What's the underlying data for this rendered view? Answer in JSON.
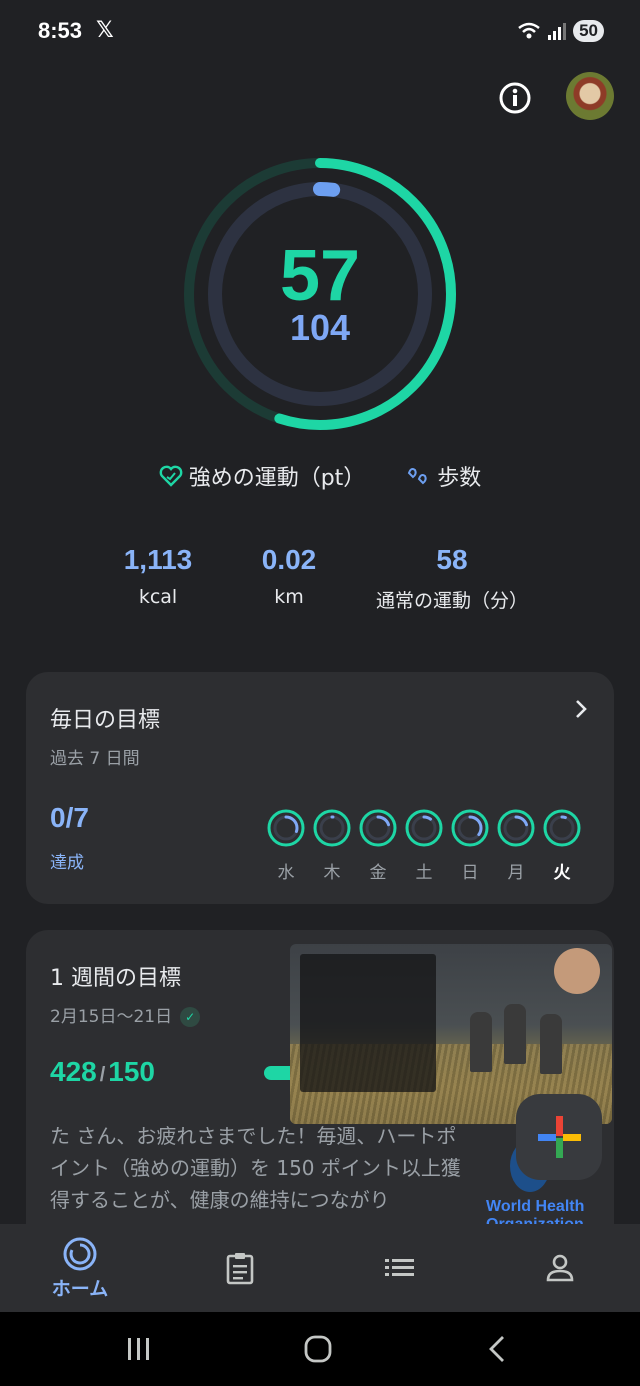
{
  "status_bar": {
    "time": "8:53",
    "battery": "50",
    "x_icon": "x-icon"
  },
  "rings": {
    "heart_points": "57",
    "steps": "104",
    "heart_fraction": 0.55,
    "steps_fraction": 0.02
  },
  "legend": {
    "heart_label": "強めの運動（pt）",
    "steps_label": "歩数"
  },
  "stats": [
    {
      "value": "1,113",
      "label": "kcal"
    },
    {
      "value": "0.02",
      "label": "km"
    },
    {
      "value": "58",
      "label": "通常の運動（分）"
    }
  ],
  "daily_goal": {
    "title": "毎日の目標",
    "subtitle": "過去 7 日間",
    "count": "0/7",
    "count_label": "達成",
    "days": [
      {
        "label": "水",
        "progress": 0.3
      },
      {
        "label": "木",
        "progress": 0.0
      },
      {
        "label": "金",
        "progress": 0.2
      },
      {
        "label": "土",
        "progress": 0.1
      },
      {
        "label": "日",
        "progress": 0.35
      },
      {
        "label": "月",
        "progress": 0.2
      },
      {
        "label": "火",
        "progress": 0.05
      }
    ]
  },
  "weekly_goal": {
    "title": "1 週間の目標",
    "date_range": "2月15日〜21日",
    "value": "428",
    "goal": "150",
    "message": "た さん、お疲れさまでした！毎週、ハートポイント（強めの運動）を 150 ポイント以上獲得することが、健康の維持につながり",
    "who_line1": "World Health",
    "who_line2": "Organization"
  },
  "nav": {
    "home_label": "ホーム"
  },
  "colors": {
    "green": "#1ed6a5",
    "blue": "#8ab4f8",
    "bg": "#202124",
    "card": "#2d2e31"
  }
}
